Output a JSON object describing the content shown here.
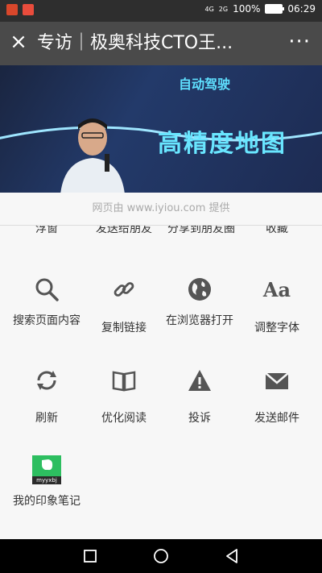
{
  "status_bar": {
    "battery": "100%",
    "time": "06:29",
    "signal_1": "4G",
    "signal_2": "2G"
  },
  "header": {
    "close_label": "×",
    "title": "专访｜极奥科技CTO王...",
    "more_label": "···"
  },
  "hero": {
    "line1": "自动驾驶",
    "line2": "高精度地图"
  },
  "sheet": {
    "provider_text": "网页由 www.iyiou.com 提供",
    "cut_row": [
      "浮窗",
      "发送给朋友",
      "分享到朋友圈",
      "收藏"
    ],
    "row1": [
      "搜索页面内容",
      "复制链接",
      "在浏览器打开",
      "调整字体"
    ],
    "row2": [
      "刷新",
      "优化阅读",
      "投诉",
      "发送邮件"
    ],
    "row3": [
      "我的印象笔记"
    ],
    "evernote_badge": "myyxbj"
  },
  "icons": {
    "search": "search-icon",
    "link": "link-icon",
    "globe": "globe-icon",
    "font": "font-size-icon",
    "refresh": "refresh-icon",
    "book": "book-icon",
    "warning": "warning-icon",
    "mail": "mail-icon",
    "evernote": "evernote-icon"
  },
  "font_icon_text": "Aa"
}
